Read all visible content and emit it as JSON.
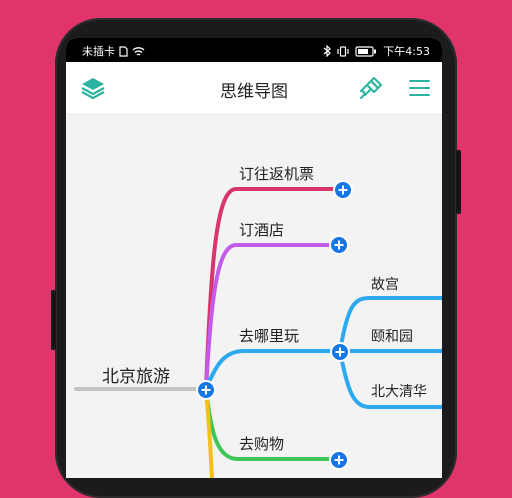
{
  "status_bar": {
    "carrier": "未插卡",
    "time": "下午4:53"
  },
  "app_bar": {
    "title": "思维导图",
    "left_icon": "layers-icon",
    "right_icons": [
      "brush-icon",
      "menu-icon"
    ],
    "accent_color": "#2bb3a0"
  },
  "mindmap": {
    "root": "北京旅游",
    "branches": [
      {
        "label": "订往返机票",
        "color": "#d8356a"
      },
      {
        "label": "订酒店",
        "color": "#c45bea"
      },
      {
        "label": "去哪里玩",
        "color": "#2da9f0",
        "children": [
          "故宫",
          "颐和园",
          "北大清华"
        ]
      },
      {
        "label": "去购物",
        "color": "#3ec756"
      }
    ],
    "plus_color": "#1576e5"
  }
}
